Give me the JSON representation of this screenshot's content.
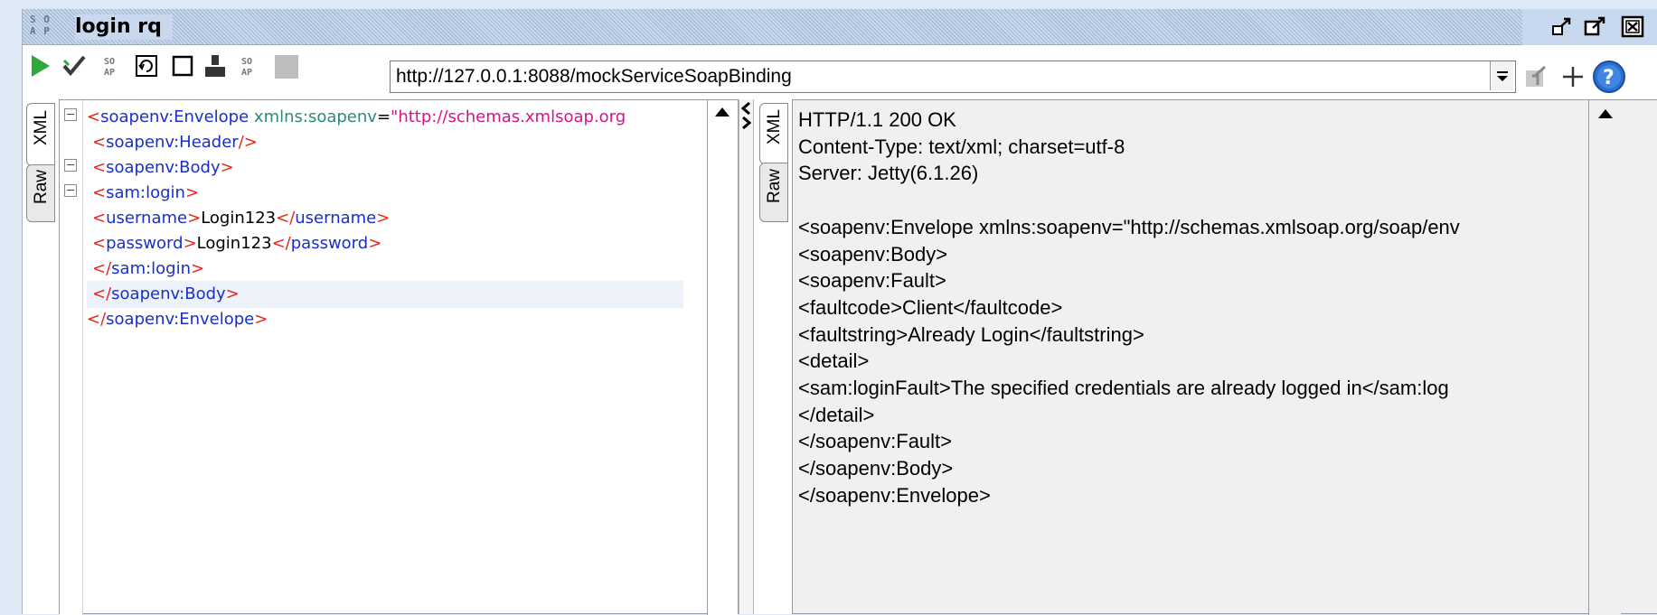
{
  "window": {
    "title": "login rq",
    "logo_text": "SOAP"
  },
  "toolbar": {
    "url": "http://127.0.0.1:8088/mockServiceSoapBinding",
    "icons": [
      "play-icon",
      "check-icon",
      "soap-icon",
      "refresh-icon",
      "square-icon",
      "user-icon",
      "soap-icon",
      "stop-icon",
      "settings-icon",
      "plus-icon",
      "help-icon"
    ]
  },
  "request": {
    "tabs": [
      "XML",
      "Raw"
    ],
    "lines": [
      {
        "indent": 0,
        "parts": [
          [
            "br",
            "<"
          ],
          [
            "tag",
            "soapenv:Envelope"
          ],
          [
            "txt",
            " "
          ],
          [
            "attr",
            "xmlns:soapenv"
          ],
          [
            "txt",
            "="
          ],
          [
            "val",
            "\"http://schemas.xmlsoap.org"
          ]
        ]
      },
      {
        "indent": 1,
        "parts": [
          [
            "br",
            "<"
          ],
          [
            "tag",
            "soapenv:Header"
          ],
          [
            "br",
            "/>"
          ]
        ]
      },
      {
        "indent": 1,
        "parts": [
          [
            "br",
            "<"
          ],
          [
            "tag",
            "soapenv:Body"
          ],
          [
            "br",
            ">"
          ]
        ]
      },
      {
        "indent": 1,
        "parts": [
          [
            "br",
            "<"
          ],
          [
            "tag",
            "sam:login"
          ],
          [
            "br",
            ">"
          ]
        ]
      },
      {
        "indent": 1,
        "parts": [
          [
            "br",
            "<"
          ],
          [
            "tag",
            "username"
          ],
          [
            "br",
            ">"
          ],
          [
            "txt",
            "Login123"
          ],
          [
            "br",
            "</"
          ],
          [
            "tag",
            "username"
          ],
          [
            "br",
            ">"
          ]
        ]
      },
      {
        "indent": 1,
        "parts": [
          [
            "br",
            "<"
          ],
          [
            "tag",
            "password"
          ],
          [
            "br",
            ">"
          ],
          [
            "txt",
            "Login123"
          ],
          [
            "br",
            "</"
          ],
          [
            "tag",
            "password"
          ],
          [
            "br",
            ">"
          ]
        ]
      },
      {
        "indent": 1,
        "parts": [
          [
            "br",
            "</"
          ],
          [
            "tag",
            "sam:login"
          ],
          [
            "br",
            ">"
          ]
        ]
      },
      {
        "indent": 1,
        "parts": [
          [
            "br",
            "</"
          ],
          [
            "tag",
            "soapenv:Body"
          ],
          [
            "br",
            ">"
          ]
        ]
      },
      {
        "indent": 0,
        "parts": [
          [
            "br",
            "</"
          ],
          [
            "tag",
            "soapenv:Envelope"
          ],
          [
            "br",
            ">"
          ]
        ]
      }
    ]
  },
  "response": {
    "tabs": [
      "XML",
      "Raw"
    ],
    "lines": [
      "HTTP/1.1 200 OK",
      "Content-Type: text/xml; charset=utf-8",
      "Server: Jetty(6.1.26)",
      "",
      "<soapenv:Envelope xmlns:soapenv=\"http://schemas.xmlsoap.org/soap/env",
      " <soapenv:Body>",
      " <soapenv:Fault>",
      " <faultcode>Client</faultcode>",
      " <faultstring>Already Login</faultstring>",
      " <detail>",
      " <sam:loginFault>The specified credentials are already logged in</sam:log",
      " </detail>",
      " </soapenv:Fault>",
      " </soapenv:Body>",
      "</soapenv:Envelope>"
    ]
  }
}
